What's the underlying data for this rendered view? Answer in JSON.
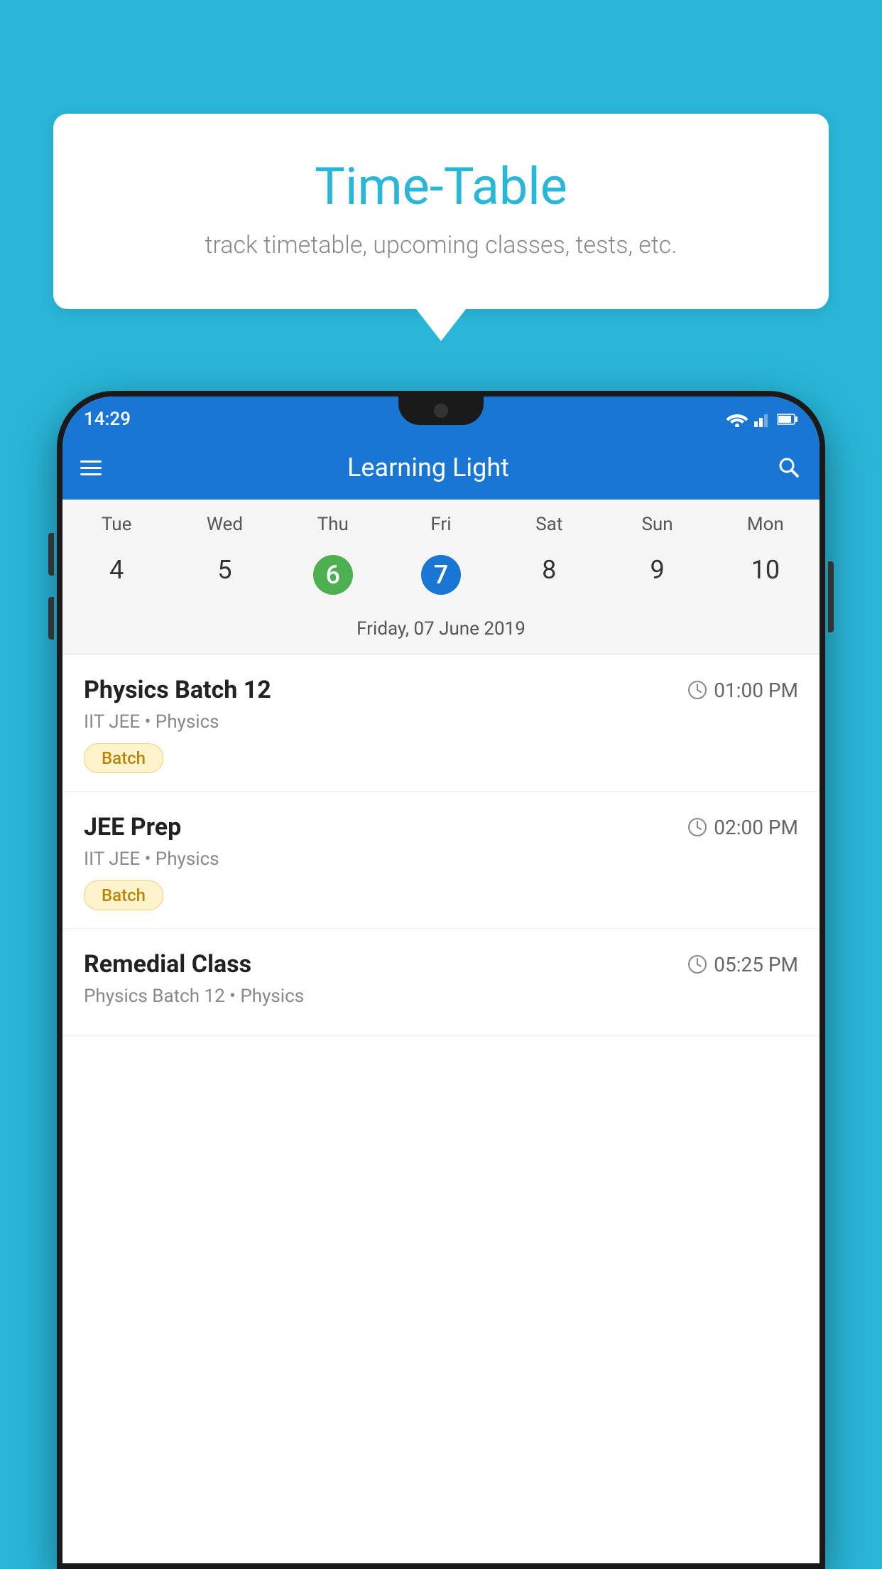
{
  "background_color": "#29B6D8",
  "tooltip": {
    "title": "Time-Table",
    "subtitle": "track timetable, upcoming classes, tests, etc."
  },
  "app": {
    "name": "Learning Light",
    "status_time": "14:29"
  },
  "calendar": {
    "selected_date_label": "Friday, 07 June 2019",
    "days": [
      "Tue",
      "Wed",
      "Thu",
      "Fri",
      "Sat",
      "Sun",
      "Mon"
    ],
    "dates": [
      {
        "number": "4",
        "state": "normal"
      },
      {
        "number": "5",
        "state": "normal"
      },
      {
        "number": "6",
        "state": "today"
      },
      {
        "number": "7",
        "state": "selected"
      },
      {
        "number": "8",
        "state": "normal"
      },
      {
        "number": "9",
        "state": "normal"
      },
      {
        "number": "10",
        "state": "normal"
      }
    ]
  },
  "schedule_items": [
    {
      "title": "Physics Batch 12",
      "time": "01:00 PM",
      "subtitle": "IIT JEE • Physics",
      "badge": "Batch"
    },
    {
      "title": "JEE Prep",
      "time": "02:00 PM",
      "subtitle": "IIT JEE • Physics",
      "badge": "Batch"
    },
    {
      "title": "Remedial Class",
      "time": "05:25 PM",
      "subtitle": "Physics Batch 12 • Physics",
      "badge": null
    }
  ],
  "labels": {
    "menu_icon": "≡",
    "search_icon": "🔍",
    "batch_badge": "Batch"
  }
}
